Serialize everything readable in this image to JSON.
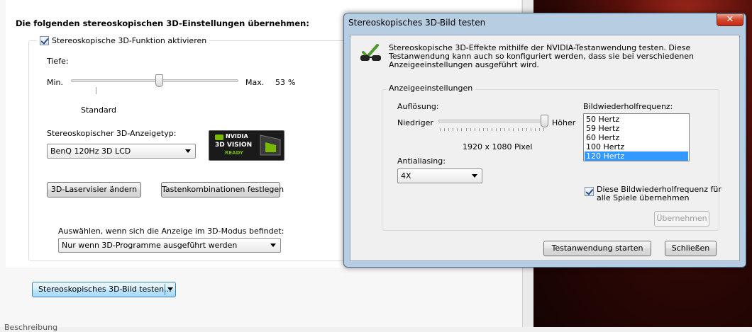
{
  "panel": {
    "heading": "Die folgenden stereoskopischen 3D-Einstellungen übernehmen:",
    "enable_checkbox": {
      "label": "Stereoskopische 3D-Funktion aktivieren",
      "checked": true
    },
    "depth": {
      "label": "Tiefe:",
      "min_label": "Min.",
      "max_label": "Max.",
      "value": "53",
      "unit": "%",
      "standard_label": "Standard"
    },
    "display_type": {
      "label": "Stereoskopischer 3D-Anzeigetyp:",
      "value": "BenQ 120Hz 3D LCD"
    },
    "badge": {
      "brand": "NVIDIA",
      "line1": "3D VISION",
      "line2": "READY"
    },
    "laser_button": "3D-Laservisier ändern",
    "hotkeys_button": "Tastenkombinationen festlegen",
    "mode_label": "Auswählen, wenn sich die Anzeige im 3D-Modus befindet:",
    "mode_value": "Nur wenn 3D-Programme ausgeführt werden",
    "test_button": "Stereoskopisches 3D-Bild testen...",
    "footer_text": "Beschreibung"
  },
  "dialog": {
    "title": "Stereoskopisches 3D-Bild testen",
    "close_glyph": "✕",
    "intro": "Stereoskopische 3D-Effekte mithilfe der NVIDIA-Testanwendung testen. Diese Testanwendung kann auch so konfiguriert werden, dass sie bei verschiedenen Anzeigeeinstellungen ausgeführt wird.",
    "group_label": "Anzeigeeinstellungen",
    "resolution": {
      "label": "Auflösung:",
      "low_label": "Niedriger",
      "high_label": "Höher",
      "value": "1920 x 1080 Pixel",
      "level": 1.0
    },
    "antialiasing": {
      "label": "Antialiasing:",
      "value": "4X"
    },
    "refresh": {
      "label": "Bildwiederholfrequenz:",
      "options": [
        "50 Hertz",
        "59 Hertz",
        "60 Hertz",
        "100 Hertz",
        "120 Hertz"
      ],
      "selected_index": 4
    },
    "apply_all_checkbox": {
      "line1": "Diese Bildwiederholfrequenz für",
      "line2": "alle Spiele übernehmen",
      "checked": true
    },
    "accept_button": "Übernehmen",
    "start_button": "Testanwendung starten",
    "close_button": "Schließen"
  },
  "colors": {
    "selection": "#3399ff",
    "title_bar": "#b7cde2",
    "close_red": "#c22c13"
  }
}
